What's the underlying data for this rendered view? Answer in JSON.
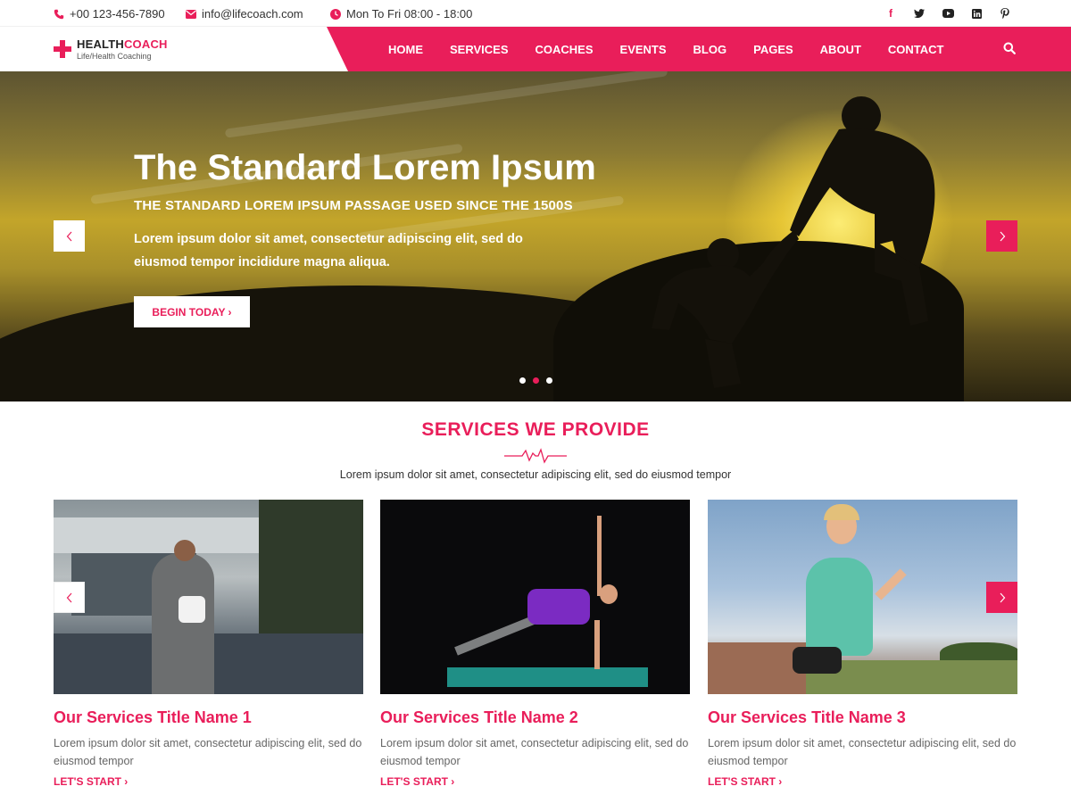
{
  "topbar": {
    "phone": "+00 123-456-7890",
    "email": "info@lifecoach.com",
    "hours": "Mon To Fri 08:00 - 18:00",
    "socials": [
      "facebook-icon",
      "twitter-icon",
      "youtube-icon",
      "linkedin-icon",
      "pinterest-icon"
    ]
  },
  "brand": {
    "name_part1": "HEALTH",
    "name_part2": "COACH",
    "tagline": "Life/Health Coaching"
  },
  "nav": {
    "items": [
      "HOME",
      "SERVICES",
      "COACHES",
      "EVENTS",
      "BLOG",
      "PAGES",
      "ABOUT",
      "CONTACT"
    ]
  },
  "hero": {
    "title": "The Standard Lorem Ipsum",
    "subtitle": "THE STANDARD LOREM IPSUM PASSAGE USED SINCE THE 1500S",
    "text": "Lorem ipsum dolor sit amet, consectetur adipiscing elit, sed do eiusmod tempor incididure magna aliqua.",
    "cta": "BEGIN TODAY ›",
    "slide_count": 3,
    "active_slide": 2
  },
  "services": {
    "title": "SERVICES WE PROVIDE",
    "subtitle": "Lorem ipsum dolor sit amet, consectetur adipiscing elit, sed do eiusmod tempor",
    "cards": [
      {
        "title": "Our Services Title Name 1",
        "desc": "Lorem ipsum dolor sit amet, consectetur adipiscing elit, sed do eiusmod tempor",
        "link": "LET'S START ›"
      },
      {
        "title": "Our Services Title Name 2",
        "desc": "Lorem ipsum dolor sit amet, consectetur adipiscing elit, sed do eiusmod tempor",
        "link": "LET'S START ›"
      },
      {
        "title": "Our Services Title Name 3",
        "desc": "Lorem ipsum dolor sit amet, consectetur adipiscing elit, sed do eiusmod tempor",
        "link": "LET'S START ›"
      }
    ]
  },
  "colors": {
    "accent": "#e91e5a",
    "text": "#333333"
  }
}
